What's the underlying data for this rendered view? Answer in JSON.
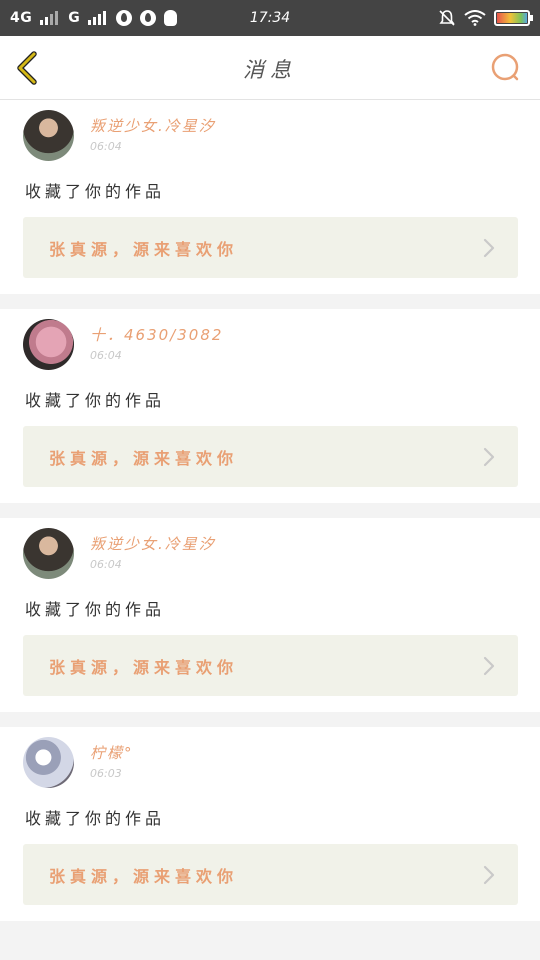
{
  "status_bar": {
    "network_left": "4G",
    "network_right": "G",
    "time": "17:34"
  },
  "nav": {
    "title": "消息",
    "back_icon": "chevron-left-icon",
    "search_icon": "search-icon",
    "accent_color": "#e9a074",
    "back_color": "#d4b816"
  },
  "messages": [
    {
      "username": "叛逆少女.冷星汐",
      "time": "06:04",
      "action": "收藏了你的作品",
      "work_title": "张真源，源来喜欢你"
    },
    {
      "username": "十．4630/3082",
      "time": "06:04",
      "action": "收藏了你的作品",
      "work_title": "张真源，源来喜欢你"
    },
    {
      "username": "叛逆少女.冷星汐",
      "time": "06:04",
      "action": "收藏了你的作品",
      "work_title": "张真源，源来喜欢你"
    },
    {
      "username": "柠檬°",
      "time": "06:03",
      "action": "收藏了你的作品",
      "work_title": "张真源，源来喜欢你"
    }
  ]
}
